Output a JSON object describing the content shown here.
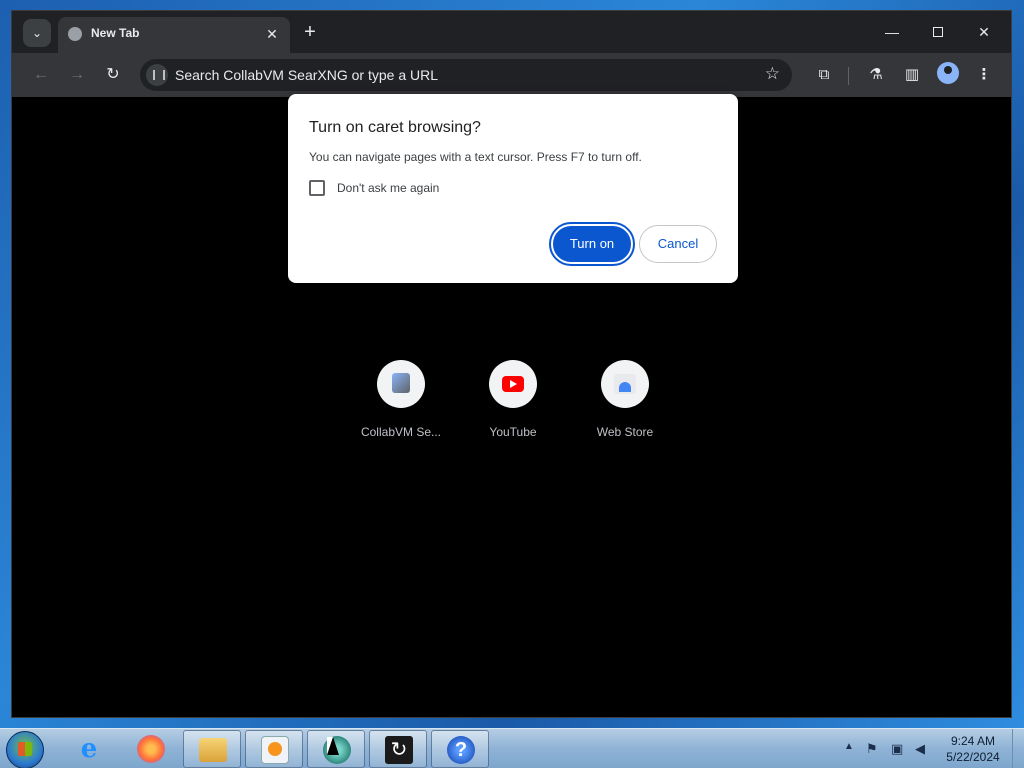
{
  "browser": {
    "tab_title": "New Tab",
    "tab_close": "✕",
    "new_tab": "+",
    "omnibox_placeholder": "Search CollabVM SearXNG or type a URL",
    "window_controls": {
      "minimize": "—",
      "close": "✕"
    }
  },
  "dialog": {
    "title": "Turn on caret browsing?",
    "body": "You can navigate pages with a text cursor. Press F7 to turn off.",
    "checkbox_label": "Don't ask me again",
    "checkbox_checked": false,
    "primary_button": "Turn on",
    "secondary_button": "Cancel"
  },
  "shortcuts": [
    {
      "label": "CollabVM Se...",
      "icon": "collabvm-icon"
    },
    {
      "label": "YouTube",
      "icon": "youtube-icon"
    },
    {
      "label": "Web Store",
      "icon": "web-store-icon"
    }
  ],
  "taskbar": {
    "apps": [
      "internet-explorer",
      "firefox",
      "file-explorer",
      "media-player",
      "collabvm",
      "sync-app",
      "help"
    ],
    "clock_time": "9:24 AM",
    "clock_date": "5/22/2024"
  },
  "colors": {
    "primary_button": "#0b57d0",
    "browser_frame": "#202124",
    "toolbar": "#35363a",
    "youtube_red": "#ff0000"
  }
}
